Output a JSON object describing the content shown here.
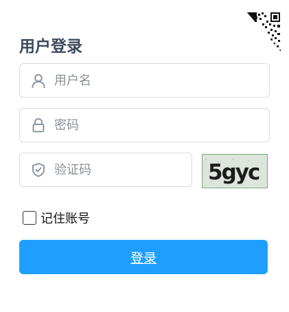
{
  "login": {
    "title": "用户登录",
    "username": {
      "value": "",
      "placeholder": "用户名",
      "icon": "user-icon"
    },
    "password": {
      "value": "",
      "placeholder": "密码",
      "icon": "lock-icon"
    },
    "captcha": {
      "value": "",
      "placeholder": "验证码",
      "icon": "shield-icon",
      "image_text": "5gyc"
    },
    "remember": {
      "label": "记住账号",
      "checked": false
    },
    "submit_label": "登录"
  },
  "colors": {
    "accent": "#1e9fff",
    "title": "#3b4a5a",
    "border": "#d6dbe1",
    "icon": "#8a96a6"
  }
}
